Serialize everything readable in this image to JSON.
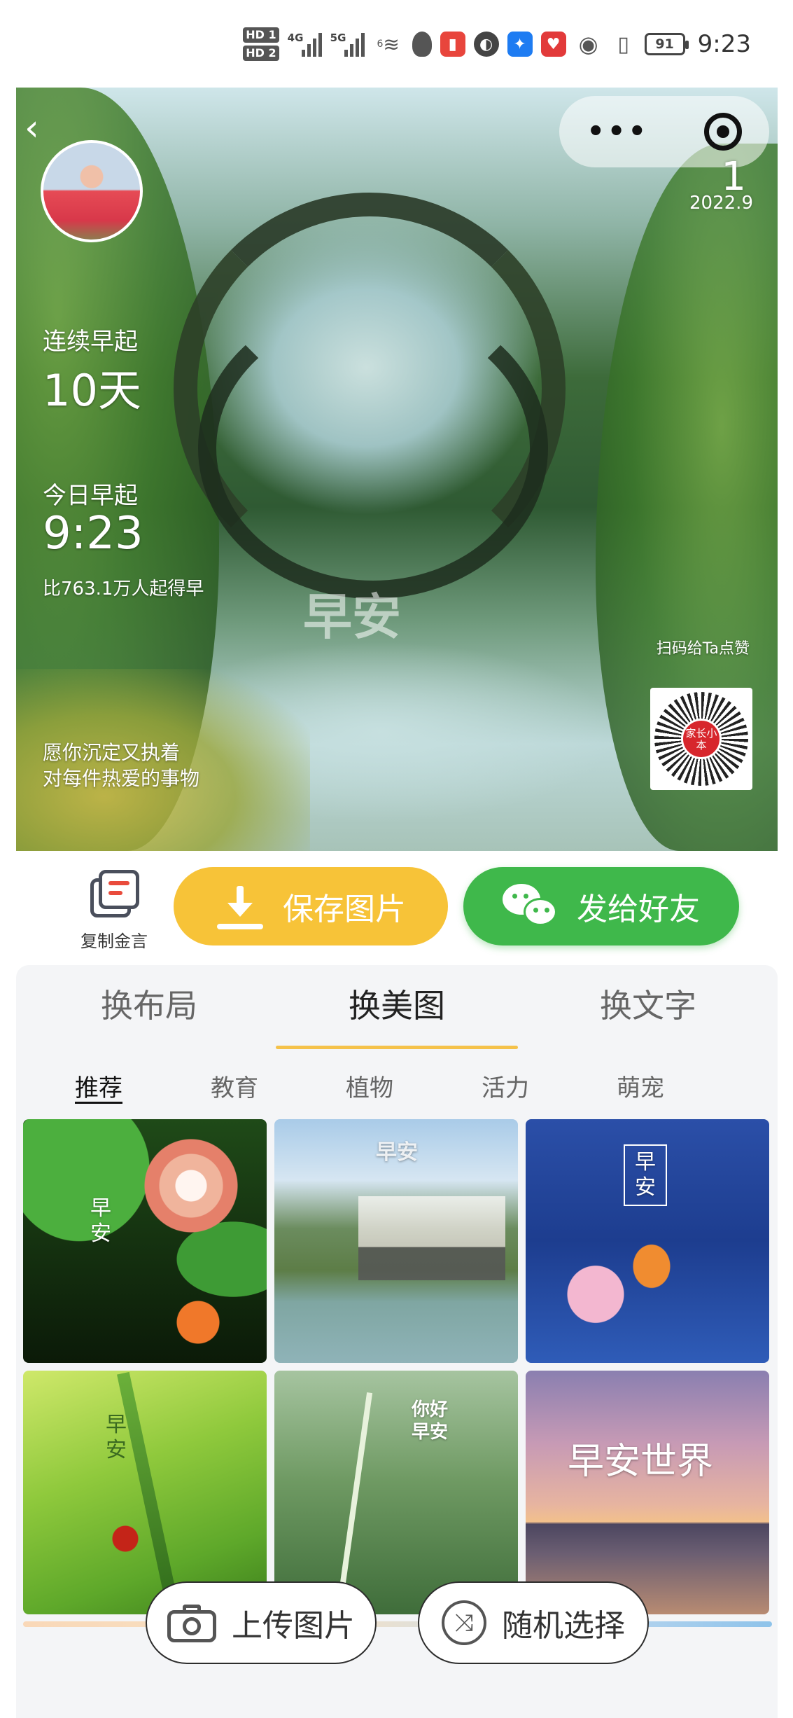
{
  "status_bar": {
    "hd1": "HD 1",
    "hd2": "HD 2",
    "net1": "4G",
    "net2": "5G",
    "wifi": "6",
    "battery": "91",
    "time": "9:23"
  },
  "hero": {
    "date_day": "1",
    "date_ym": "2022.9",
    "streak_label": "连续早起",
    "streak_value": "10天",
    "today_label": "今日早起",
    "today_time": "9:23",
    "rank_text": "比763.1万人起得早",
    "watermark": "早安",
    "scan_text": "扫码给Ta点赞",
    "qr_logo": "家长小本",
    "quote_line1": "愿你沉定又执着",
    "quote_line2": "对每件热爱的事物"
  },
  "actions": {
    "copy_label": "复制金言",
    "save_label": "保存图片",
    "send_label": "发给好友"
  },
  "tabs": {
    "layout": "换布局",
    "image": "换美图",
    "text": "换文字"
  },
  "subtabs": {
    "recommend": "推荐",
    "education": "教育",
    "plants": "植物",
    "vitality": "活力",
    "pets": "萌宠"
  },
  "tiles": {
    "t1": "早安",
    "t2": "早安",
    "t3": "早安",
    "t4": "早安",
    "t5": "你好早安",
    "t6": "早安世界"
  },
  "floating": {
    "upload_label": "上传图片",
    "random_label": "随机选择"
  }
}
